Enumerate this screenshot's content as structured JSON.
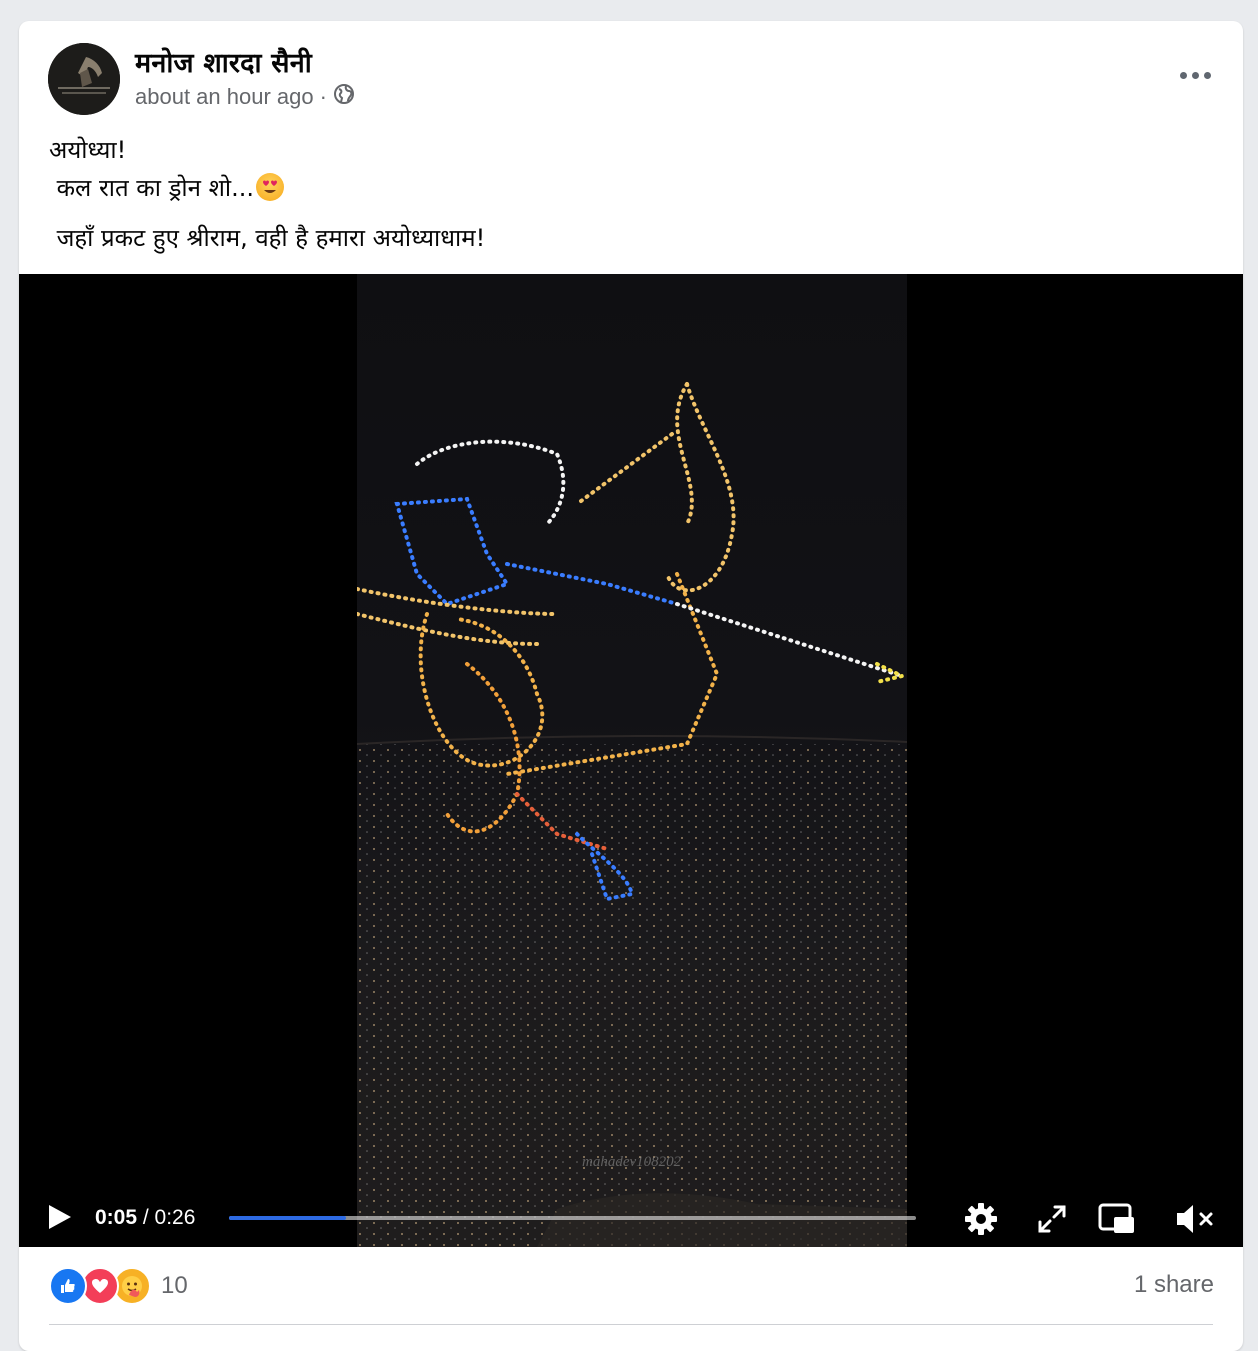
{
  "post": {
    "author": "मनोज शारदा सैनी",
    "timestamp": "about an hour ago",
    "separator": "·",
    "privacy_icon": "globe-icon",
    "text_line1": "अयोध्या!",
    "text_line2": " कल रात का ड्रोन शो...",
    "text_line3": " जहाँ प्रकट हुए श्रीराम, वही है हमारा अयोध्याधाम!",
    "emoji_icon": "heart-eyes-emoji-icon"
  },
  "video": {
    "current_time": "0:05",
    "time_separator": " / ",
    "duration": "0:26",
    "progress_fraction": 0.17,
    "watermark": "mahadev108202",
    "accent": "#2d6ae3"
  },
  "footer": {
    "reaction_count": "10",
    "shares": "1 share",
    "reaction_icons": [
      "like-icon",
      "love-icon",
      "care-icon"
    ]
  }
}
